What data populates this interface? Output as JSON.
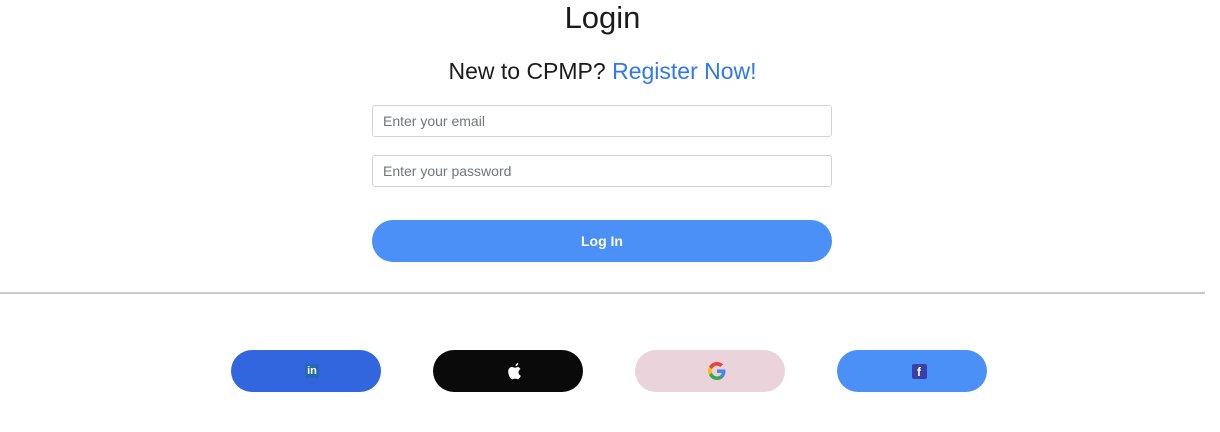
{
  "login": {
    "title": "Login",
    "prompt": "New to CPMP?",
    "register_link": "Register Now!",
    "email_placeholder": "Enter your email",
    "password_placeholder": "Enter your password",
    "login_button": "Log In"
  },
  "social": {
    "linkedin": {
      "icon": "linkedin-icon",
      "glyph": "in",
      "color": "#3266df"
    },
    "apple": {
      "icon": "apple-icon",
      "color": "#0a0a0a"
    },
    "google": {
      "icon": "google-icon",
      "color": "#ead3da"
    },
    "facebook": {
      "icon": "facebook-icon",
      "glyph": "f",
      "color": "#4a90f7"
    }
  },
  "colors": {
    "accent": "#4a90f7",
    "link": "#2f78ee",
    "divider": "#c9c9c9"
  }
}
